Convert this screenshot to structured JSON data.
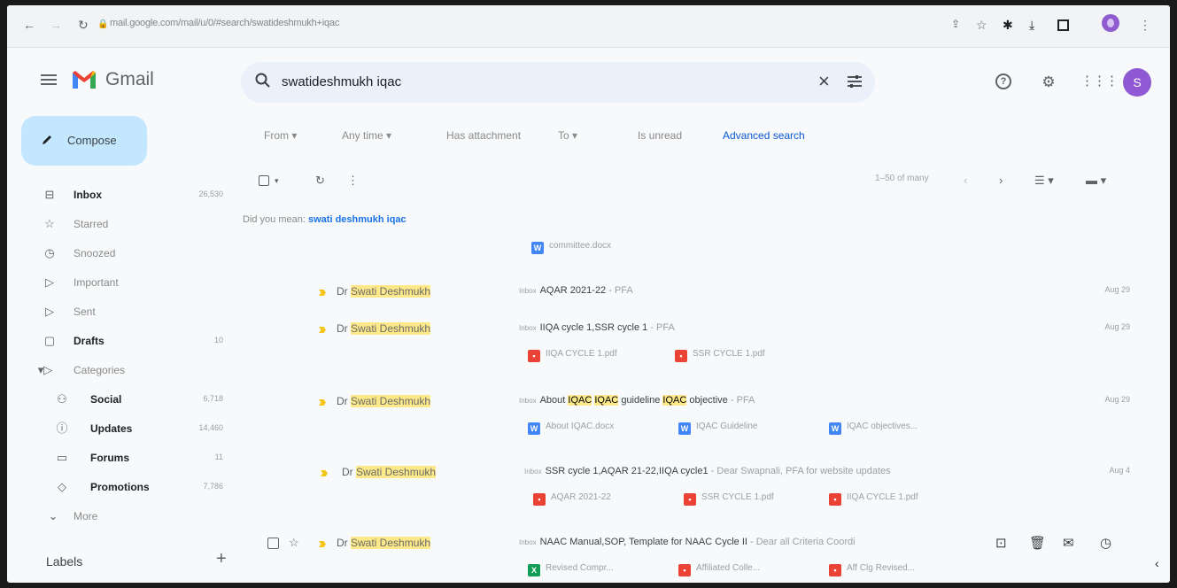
{
  "browser": {
    "url": "mail.google.com/mail/u/0/#search/swatideshmukh+iqac"
  },
  "header": {
    "app_name": "Gmail",
    "search_query": "swatideshmukh iqac",
    "avatar_letter": "S"
  },
  "compose_label": "Compose",
  "sidebar": {
    "items": [
      {
        "label": "Inbox",
        "count": "26,530",
        "bold": true,
        "icon": "inbox-icon"
      },
      {
        "label": "Starred",
        "count": "",
        "bold": false,
        "icon": "star-icon"
      },
      {
        "label": "Snoozed",
        "count": "",
        "bold": false,
        "icon": "clock-icon"
      },
      {
        "label": "Important",
        "count": "",
        "bold": false,
        "icon": "label-important-icon"
      },
      {
        "label": "Sent",
        "count": "",
        "bold": false,
        "icon": "send-icon"
      },
      {
        "label": "Drafts",
        "count": "10",
        "bold": true,
        "icon": "draft-icon"
      },
      {
        "label": "Categories",
        "count": "",
        "bold": false,
        "icon": "label-icon"
      }
    ],
    "categories": [
      {
        "label": "Social",
        "count": "6,718",
        "icon": "people-icon"
      },
      {
        "label": "Updates",
        "count": "14,460",
        "icon": "info-icon"
      },
      {
        "label": "Forums",
        "count": "11",
        "icon": "forum-icon"
      },
      {
        "label": "Promotions",
        "count": "7,786",
        "icon": "tag-icon"
      }
    ],
    "more_label": "More",
    "labels_title": "Labels"
  },
  "filters": {
    "from": "From",
    "any_time": "Any time",
    "has_attachment": "Has attachment",
    "to": "To",
    "is_unread": "Is unread",
    "advanced": "Advanced search"
  },
  "toolbar": {
    "range": "1–50 of many"
  },
  "did_you_mean": {
    "prefix": "Did you mean:",
    "suggestion": "swati deshmukh iqac"
  },
  "top_attachment": "committee.docx",
  "emails": [
    {
      "sender_prefix": "Dr ",
      "sender_highlight": "Swati Deshmukh",
      "inbox_tag": "Inbox",
      "subject": "AQAR 2021-22",
      "snippet": " - PFA",
      "date": "Aug 29"
    },
    {
      "sender_prefix": "Dr ",
      "sender_highlight": "Swati Deshmukh",
      "inbox_tag": "Inbox",
      "subject": "IIQA cycle 1,SSR cycle 1",
      "snippet": " - PFA",
      "date": "Aug 29",
      "attachments": [
        "IIQA CYCLE 1.pdf",
        "SSR CYCLE 1.pdf"
      ]
    },
    {
      "sender_prefix": "Dr ",
      "sender_highlight": "Swati Deshmukh",
      "inbox_tag": "Inbox",
      "subject_parts": [
        "About ",
        "IQAC",
        " ",
        "IQAC",
        " guideline ",
        "IQAC",
        " objective"
      ],
      "snippet": " - PFA",
      "date": "Aug 29",
      "attachments": [
        "About IQAC.docx",
        "IQAC Guideline",
        "IQAC objectives..."
      ]
    },
    {
      "sender_prefix": "Dr ",
      "sender_highlight": "Swati Deshmukh",
      "inbox_tag": "Inbox",
      "subject": "SSR cycle 1,AQAR 21-22,IIQA cycle1",
      "snippet": " - Dear Swapnali, PFA for website updates",
      "date": "Aug 4",
      "attachments": [
        "AQAR 2021-22",
        "SSR CYCLE 1.pdf",
        "IIQA CYCLE 1.pdf"
      ]
    },
    {
      "sender_prefix": "Dr ",
      "sender_highlight": "Swati Deshmukh",
      "inbox_tag": "Inbox",
      "subject": "NAAC Manual,SOP, Template for NAAC Cycle II",
      "snippet": " - Dear all Criteria Coordi",
      "date": "",
      "attachments": [
        "Revised Compr...",
        "Affiliated Colle...",
        "Aff Clg Revised..."
      ]
    }
  ]
}
